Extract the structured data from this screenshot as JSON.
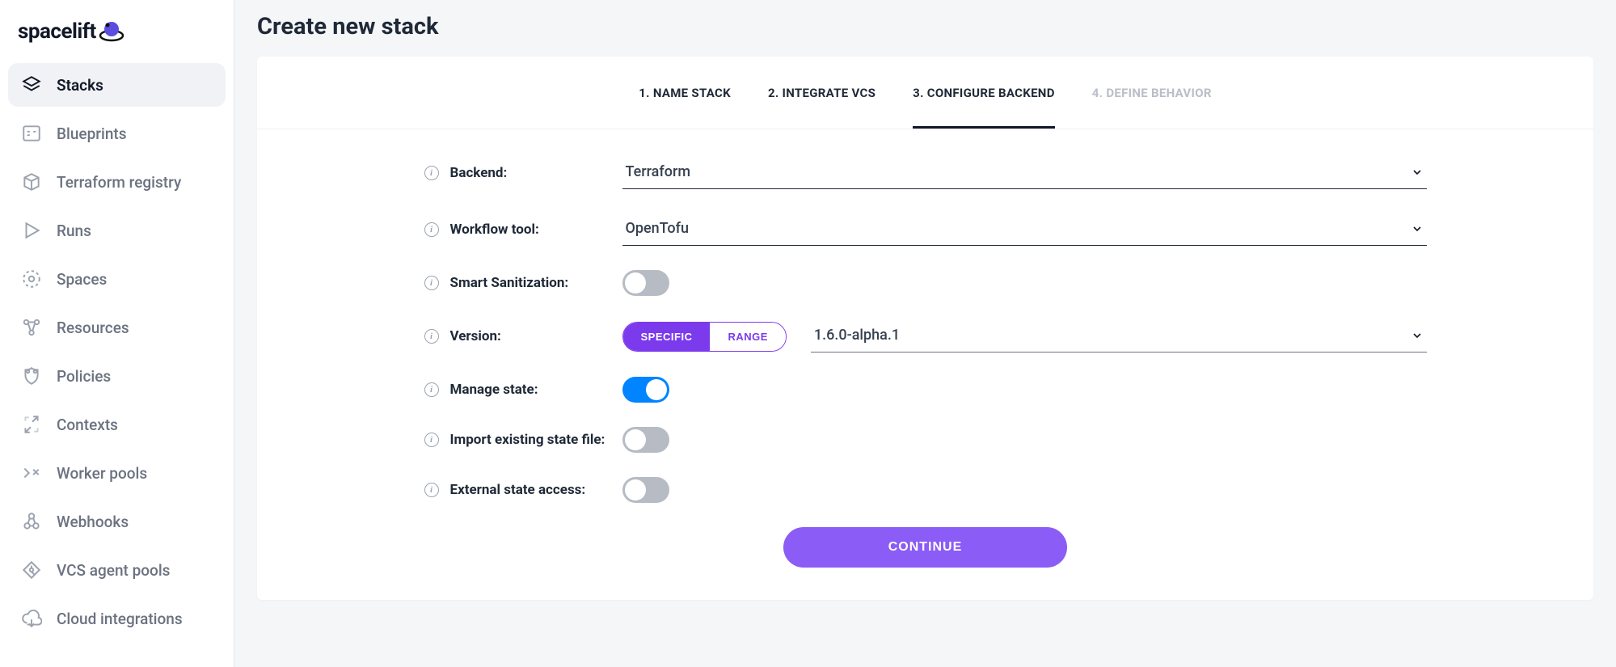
{
  "brand": "spacelift",
  "sidebar": {
    "items": [
      {
        "label": "Stacks",
        "active": true,
        "icon": "stacks"
      },
      {
        "label": "Blueprints",
        "active": false,
        "icon": "blueprints"
      },
      {
        "label": "Terraform registry",
        "active": false,
        "icon": "registry"
      },
      {
        "label": "Runs",
        "active": false,
        "icon": "runs"
      },
      {
        "label": "Spaces",
        "active": false,
        "icon": "spaces"
      },
      {
        "label": "Resources",
        "active": false,
        "icon": "resources"
      },
      {
        "label": "Policies",
        "active": false,
        "icon": "policies"
      },
      {
        "label": "Contexts",
        "active": false,
        "icon": "contexts"
      },
      {
        "label": "Worker pools",
        "active": false,
        "icon": "workers"
      },
      {
        "label": "Webhooks",
        "active": false,
        "icon": "webhooks"
      },
      {
        "label": "VCS agent pools",
        "active": false,
        "icon": "vcs"
      },
      {
        "label": "Cloud integrations",
        "active": false,
        "icon": "cloud"
      }
    ]
  },
  "page": {
    "title": "Create new stack",
    "continue": "CONTINUE"
  },
  "steps": [
    {
      "label": "1. NAME STACK",
      "state": "done"
    },
    {
      "label": "2. INTEGRATE VCS",
      "state": "done"
    },
    {
      "label": "3. CONFIGURE BACKEND",
      "state": "active"
    },
    {
      "label": "4. DEFINE BEHAVIOR",
      "state": "disabled"
    }
  ],
  "form": {
    "backend": {
      "label": "Backend:",
      "value": "Terraform"
    },
    "workflow": {
      "label": "Workflow tool:",
      "value": "OpenTofu"
    },
    "sanitization": {
      "label": "Smart Sanitization:",
      "value": false
    },
    "version": {
      "label": "Version:",
      "mode_specific": "SPECIFIC",
      "mode_range": "RANGE",
      "mode_active": "specific",
      "value": "1.6.0-alpha.1"
    },
    "manage_state": {
      "label": "Manage state:",
      "value": true
    },
    "import_state": {
      "label": "Import existing state file:",
      "value": false
    },
    "external_access": {
      "label": "External state access:",
      "value": false
    }
  }
}
